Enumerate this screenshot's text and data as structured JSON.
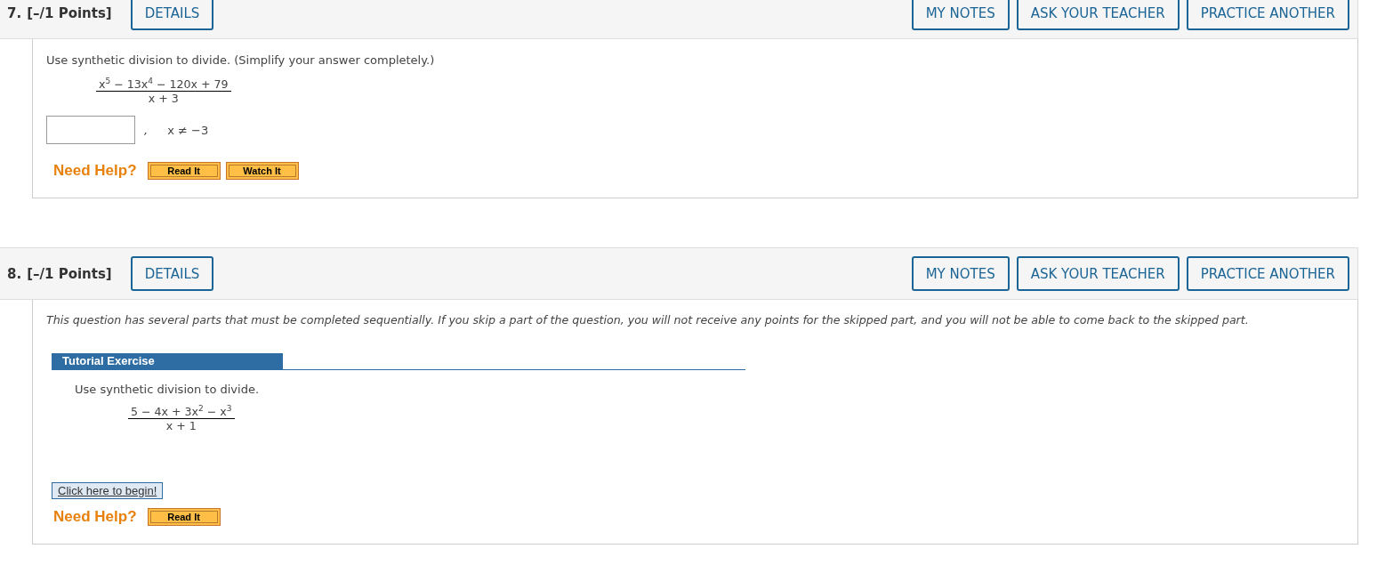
{
  "questions": [
    {
      "number": "7.",
      "points": "[–/1 Points]",
      "details_button": "DETAILS",
      "header_buttons": [
        "MY NOTES",
        "ASK YOUR TEACHER",
        "PRACTICE ANOTHER"
      ],
      "blocks": [
        {
          "kind": "instruction",
          "text": "Use synthetic division to divide. (Simplify your answer completely.)"
        },
        {
          "kind": "fraction",
          "numerator": "x$^{5}$ − 13x$^{4}$ − 120x + 79",
          "denominator": "x + 3"
        },
        {
          "kind": "answer",
          "separator": ",",
          "condition": "x ≠ −3"
        },
        {
          "kind": "need_help",
          "label": "Need Help?",
          "buttons": [
            "Read It",
            "Watch It"
          ]
        }
      ]
    },
    {
      "number": "8.",
      "points": "[–/1 Points]",
      "details_button": "DETAILS",
      "header_buttons": [
        "MY NOTES",
        "ASK YOUR TEACHER",
        "PRACTICE ANOTHER"
      ],
      "blocks": [
        {
          "kind": "intro",
          "text": "This question has several parts that must be completed sequentially. If you skip a part of the question, you will not receive any points for the skipped part, and you will not be able to come back to the skipped part."
        },
        {
          "kind": "tutorial_heading",
          "text": "Tutorial Exercise"
        },
        {
          "kind": "tutorial_text",
          "text": "Use synthetic division to divide."
        },
        {
          "kind": "fraction",
          "numerator": "5 − 4x + 3x$^{2}$ − x$^{3}$",
          "denominator": "x + 1"
        },
        {
          "kind": "begin_link",
          "text": "Click here to begin!"
        },
        {
          "kind": "need_help",
          "label": "Need Help?",
          "buttons": [
            "Read It"
          ]
        }
      ]
    }
  ]
}
